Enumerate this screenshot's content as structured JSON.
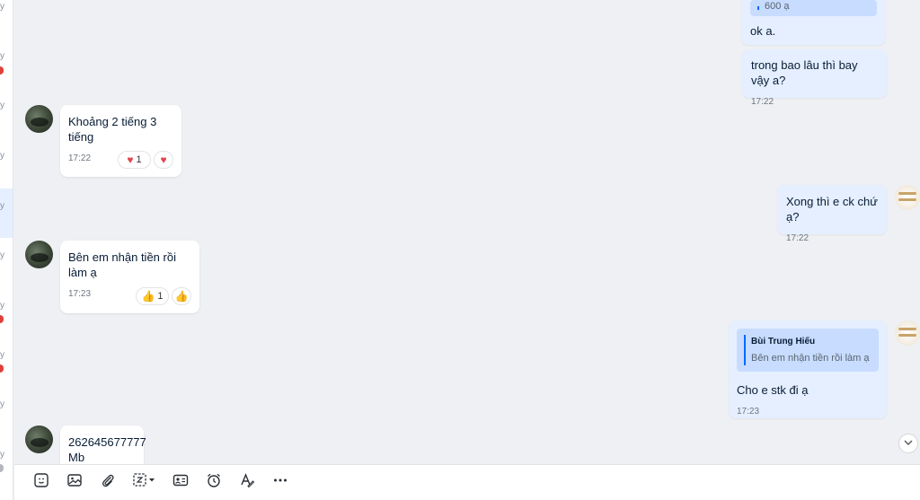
{
  "left_strip": {
    "fragments": [
      "y",
      "y",
      "y",
      "y",
      "y",
      "y",
      "y",
      "y",
      "y",
      "y"
    ]
  },
  "messages": {
    "top_quote_amount": "600 ạ",
    "ok": {
      "text": "ok a."
    },
    "m1": {
      "text": "trong bao lâu thì bay vậy a?",
      "time": "17:22"
    },
    "m2": {
      "text": "Khoảng 2 tiếng 3 tiếng",
      "time": "17:22",
      "reaction_count": "1"
    },
    "m3": {
      "text": "Xong thì e ck chứ ạ?",
      "time": "17:22"
    },
    "m4": {
      "text": "Bên em nhận tiền rồi làm ạ",
      "time": "17:23",
      "reaction_count": "1"
    },
    "m5": {
      "quote_name": "Bùi Trung Hiếu",
      "quote_text": "Bên em nhận tiền rồi làm ạ",
      "text": "Cho e stk đi ạ",
      "time": "17:23"
    },
    "m6": {
      "line1": "262645677777",
      "line2": "Mb"
    }
  },
  "toolbar": {
    "icons": [
      "sticker-icon",
      "image-icon",
      "attachment-icon",
      "screenshot-icon",
      "contact-card-icon",
      "reminder-icon",
      "format-text-icon",
      "more-icon"
    ]
  },
  "colors": {
    "background": "#eef0f3",
    "incoming_bubble": "#ffffff",
    "outgoing_bubble": "#e5efff",
    "quote_bg": "#c7dcff",
    "accent": "#0068ff",
    "heart": "#e0454f",
    "thumb": "#e7b23c"
  }
}
